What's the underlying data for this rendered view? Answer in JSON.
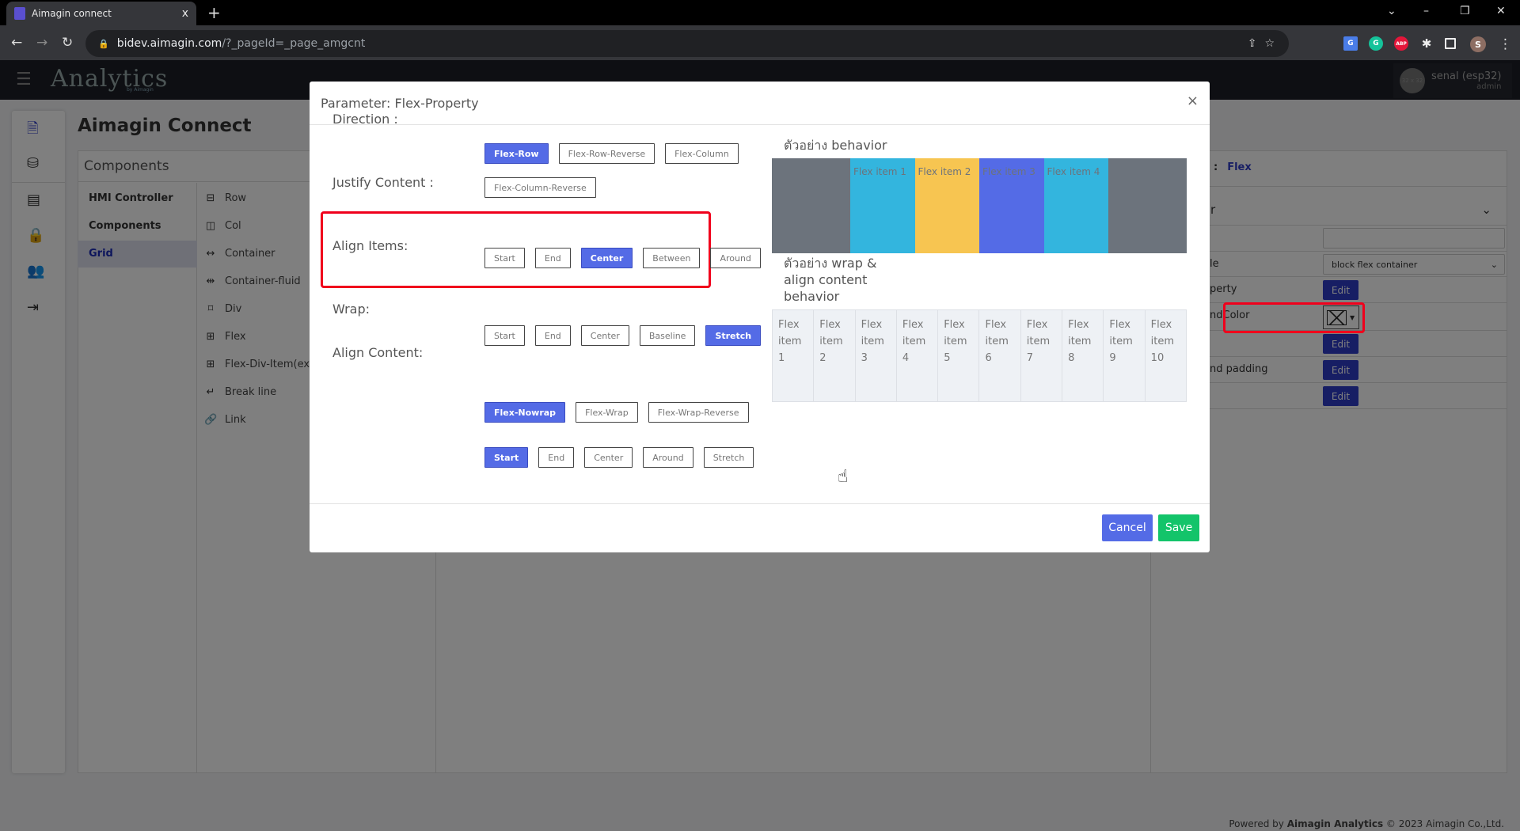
{
  "browser": {
    "tab_title": "Aimagin connect",
    "tab_close": "x",
    "new_tab": "+",
    "url_host": "bidev.aimagin.com",
    "url_path": "/?_pageId=_page_amgcnt",
    "profile_initial": "S",
    "extensions": [
      "google-translate",
      "grammarly",
      "adblock-plus",
      "extensions-puzzle",
      "side-panel"
    ],
    "extension_labels": {
      "grammarly": "G",
      "abp": "ABP"
    }
  },
  "app": {
    "brand": "Analytics",
    "brand_sub": "by Aimagin",
    "user_name": "senal (esp32)",
    "user_role": "admin",
    "avatar_placeholder": "32 x 32",
    "page_title": "Aimagin Connect",
    "card_title": "Components",
    "sidebar_icons": [
      "file-code",
      "database",
      "server",
      "lock",
      "users",
      "sign-out"
    ],
    "categories": [
      {
        "label": "HMI Controller",
        "selected": false
      },
      {
        "label": "Components",
        "selected": false
      },
      {
        "label": "Grid",
        "selected": true
      }
    ],
    "components": [
      {
        "label": "Row",
        "icon": "row-icon"
      },
      {
        "label": "Col",
        "icon": "col-icon"
      },
      {
        "label": "Container",
        "icon": "arrows-h-icon"
      },
      {
        "label": "Container-fluid",
        "icon": "arrows-h-bar-icon"
      },
      {
        "label": "Div",
        "icon": "vector-square-icon"
      },
      {
        "label": "Flex",
        "icon": "grid-icon"
      },
      {
        "label": "Flex-Div-Item(exp",
        "icon": "grid-icon"
      },
      {
        "label": "Break line",
        "icon": "return-icon"
      },
      {
        "label": "Link",
        "icon": "link-icon"
      }
    ],
    "right_panel": {
      "selected_sep": ":",
      "selected_name": "Flex",
      "section_label": "r",
      "rows": {
        "style_label": "le",
        "style_value": "block flex container",
        "property_label": "perty",
        "color_label": "Color",
        "color_fragment": "nd",
        "padding_label": "nd padding",
        "edit": "Edit"
      }
    },
    "footer": {
      "prefix": "Powered by ",
      "brand": "Aimagin Analytics",
      "suffix": " © 2023 Aimagin Co.,Ltd."
    }
  },
  "modal": {
    "title": "Parameter: Flex-Property",
    "close": "×",
    "groups": [
      {
        "label": "Direction :",
        "options": [
          "Flex-Row",
          "Flex-Row-Reverse",
          "Flex-Column",
          "Flex-Column-Reverse"
        ],
        "selected": "Flex-Row"
      },
      {
        "label": "Justify Content :",
        "options": [
          "Start",
          "End",
          "Center",
          "Between",
          "Around"
        ],
        "selected": "Center",
        "highlighted": true
      },
      {
        "label": "Align Items:",
        "options": [
          "Start",
          "End",
          "Center",
          "Baseline",
          "Stretch"
        ],
        "selected": "Stretch"
      },
      {
        "label": "Wrap:",
        "options": [
          "Flex-Nowrap",
          "Flex-Wrap",
          "Flex-Wrap-Reverse"
        ],
        "selected": "Flex-Nowrap"
      },
      {
        "label": "Align Content:",
        "options": [
          "Start",
          "End",
          "Center",
          "Around",
          "Stretch"
        ],
        "selected": "Start"
      }
    ],
    "preview1_title": "ตัวอย่าง behavior",
    "preview1_items": [
      {
        "label": "Flex item 1",
        "color": "#33b5de"
      },
      {
        "label": "Flex item 2",
        "color": "#f7c551"
      },
      {
        "label": "Flex item 3",
        "color": "#546be6"
      },
      {
        "label": "Flex item 4",
        "color": "#33b5de"
      }
    ],
    "preview2_title": "ตัวอย่าง wrap & align content behavior",
    "preview2_items": [
      "Flex item 1",
      "Flex item 2",
      "Flex item 3",
      "Flex item 4",
      "Flex item 5",
      "Flex item 6",
      "Flex item 7",
      "Flex item 8",
      "Flex item 9",
      "Flex item 10"
    ],
    "cancel": "Cancel",
    "save": "Save"
  },
  "colors": {
    "primary": "#546be6",
    "success": "#13c46a",
    "highlight": "#f0001c",
    "container": "#6c737c"
  }
}
